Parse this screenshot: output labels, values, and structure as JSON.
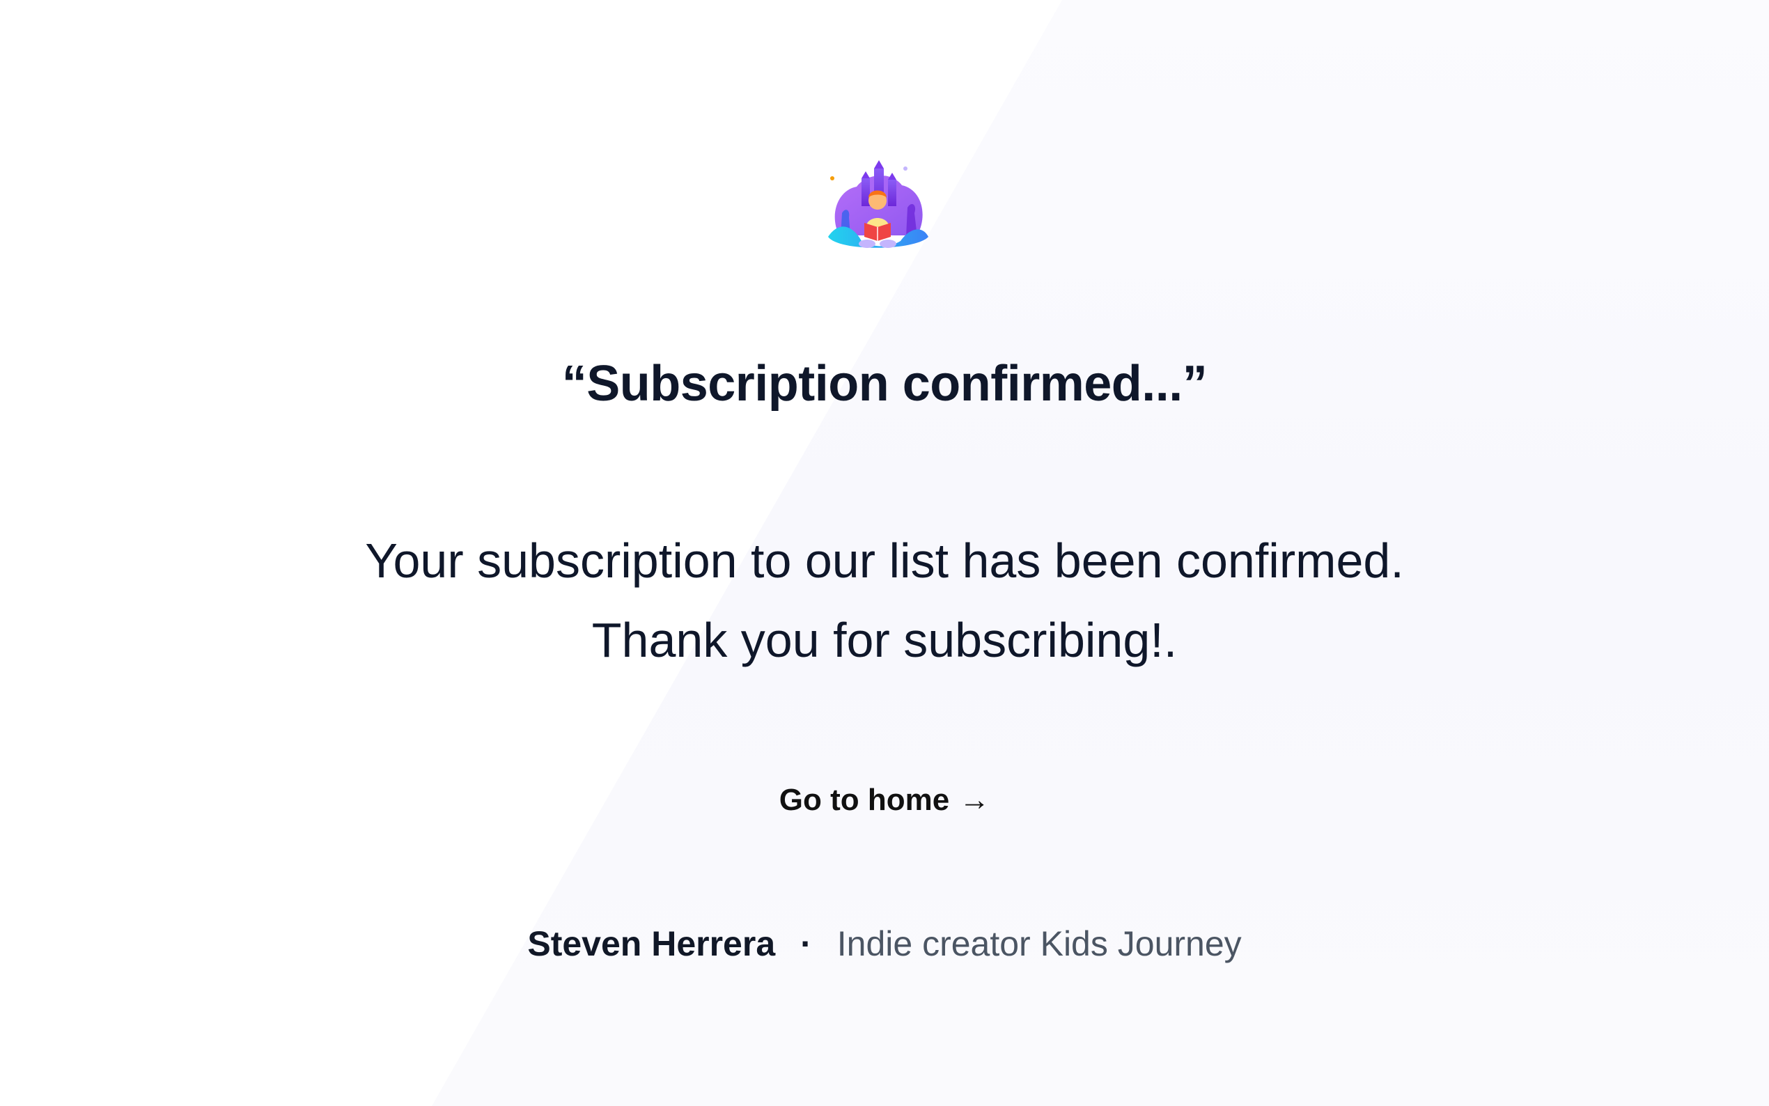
{
  "headline": "“Subscription confirmed...”",
  "message": {
    "line1": "Your subscription to our list has been confirmed.",
    "line2": "Thank you for subscribing!."
  },
  "home_link": {
    "label": "Go to home",
    "arrow": "→"
  },
  "author": {
    "name": "Steven Herrera",
    "separator": "·",
    "role": "Indie creator Kids Journey"
  },
  "logo": {
    "icon": "kids-reading-castle-logo",
    "colors": [
      "#7c3aed",
      "#a855f7",
      "#38bdf8",
      "#f97316",
      "#ef4444"
    ]
  }
}
